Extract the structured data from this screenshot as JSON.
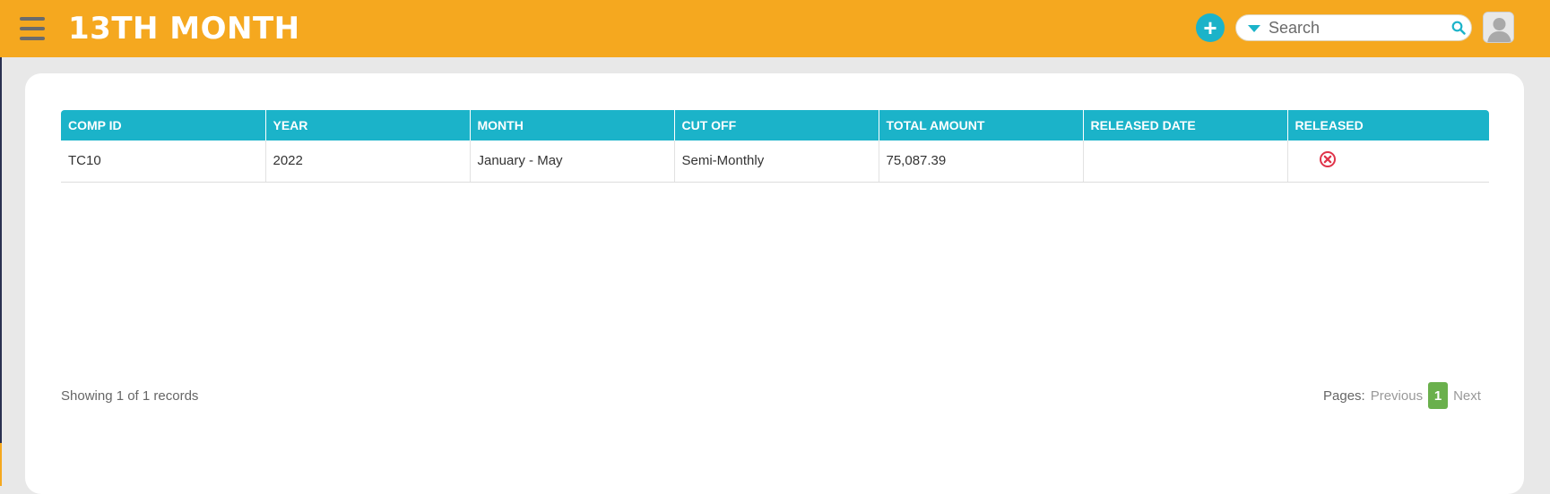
{
  "header": {
    "title": "13TH MONTH",
    "add_icon": "plus-circle-icon",
    "search_placeholder": "Search",
    "menu_icon": "hamburger-icon",
    "search_icon": "magnifier-icon",
    "avatar_icon": "user-silhouette-icon",
    "colors": {
      "bar": "#f5a81f",
      "accent": "#1bb3c9"
    }
  },
  "table": {
    "columns": [
      "COMP ID",
      "YEAR",
      "MONTH",
      "CUT OFF",
      "TOTAL AMOUNT",
      "RELEASED DATE",
      "RELEASED"
    ],
    "rows": [
      {
        "comp_id": "TC10",
        "year": "2022",
        "month": "January - May",
        "cut_off": "Semi-Monthly",
        "total_amount": "75,087.39",
        "released_date": "",
        "released_icon": "x-circle-icon",
        "released_color": "#e0344a"
      }
    ]
  },
  "footer": {
    "records_text": "Showing 1 of 1 records",
    "pages_label": "Pages:",
    "previous_label": "Previous",
    "current_page": "1",
    "next_label": "Next",
    "page_color": "#6ab04c"
  }
}
